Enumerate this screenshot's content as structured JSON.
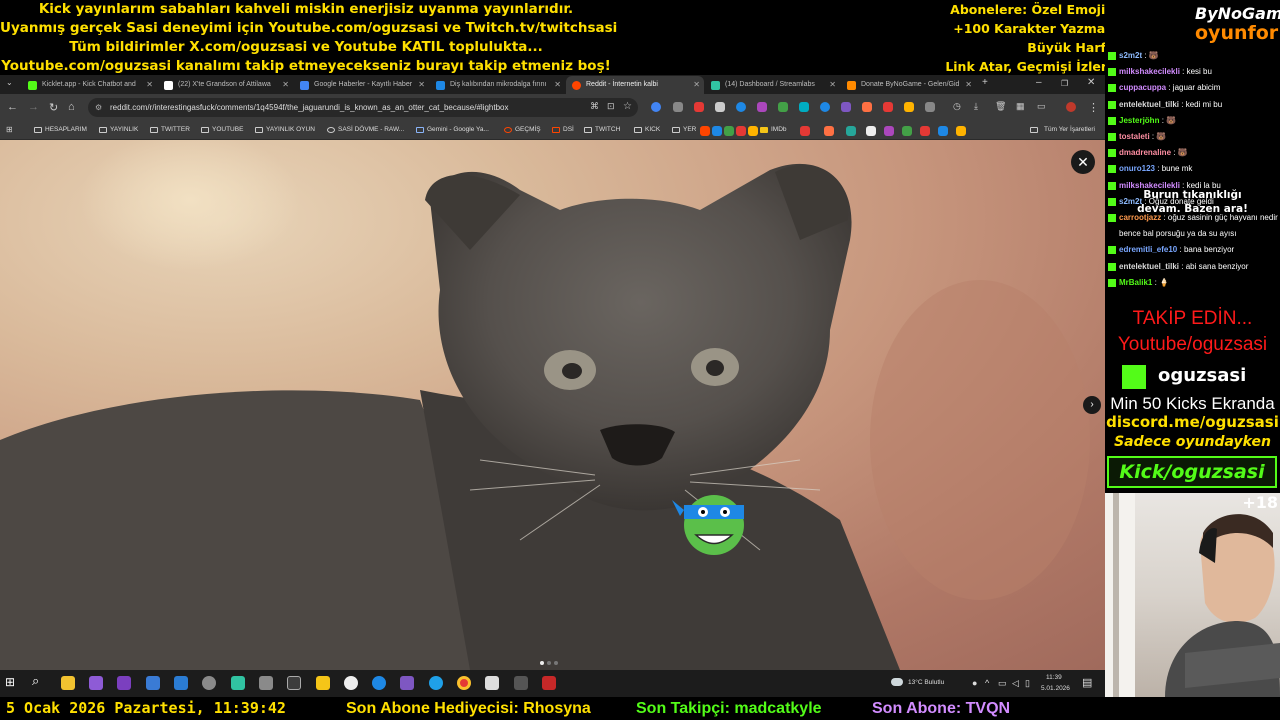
{
  "overlay": {
    "announce_lines": [
      "Kick yayınlarım sabahları kahveli miskin enerjisiz uyanma yayınlarıdır.",
      "Uyanmış gerçek Sasi deneyimi için Youtube.com/oguzsasi ve Twitch.tv/twitchsasi",
      "Tüm bildirimler X.com/oguzsasi ve Youtube KATIL toplulukta...",
      "Youtube.com/oguzsasi kanalımı takip etmeyecekseniz burayı takip etmeniz boş!"
    ],
    "sub_perks_lines": [
      "Abonelere: Özel Emoji,",
      "+100 Karakter Yazma,",
      "Büyük Harf,",
      "Link Atar, Geçmişi İzler."
    ],
    "accent_color": "#ffe000"
  },
  "browser": {
    "tabs": [
      {
        "label": "Kicklet.app - Kick Chatbot and",
        "color": "#53fc18",
        "active": false
      },
      {
        "label": "(22) X'te Grandson of Attilawa",
        "color": "#ffffff",
        "active": false
      },
      {
        "label": "Google Haberler - Kayıtlı Haber",
        "color": "#4285f4",
        "active": false
      },
      {
        "label": "Diş kalıbından mikrodalga fırını",
        "color": "#1e88e5",
        "active": false
      },
      {
        "label": "Reddit - İnternetin kalbi",
        "color": "#ff4500",
        "active": true
      },
      {
        "label": "(14) Dashboard / Streamlabs",
        "color": "#31c3a2",
        "active": false
      },
      {
        "label": "Donate ByNoGame - Gelen/Gid",
        "color": "#ff8a00",
        "active": false
      }
    ],
    "new_tab_label": "+",
    "url": "reddit.com/r/interestingasfuck/comments/1q4594f/the_jaguarundi_is_known_as_an_otter_cat_because/#lightbox",
    "bookmarks": [
      "HESAPLARIM",
      "YAYINLIK",
      "TWITTER",
      "YOUTUBE",
      "YAYINLIK OYUN",
      "SASİ DÖVME - RAW...",
      "Gemini - Google Ya...",
      "GEÇMİŞ",
      "DSİ",
      "TWITCH",
      "KICK",
      "YER",
      "IMDb"
    ],
    "all_bookmarks_label": "Tüm Yer İşaretleri",
    "lightbox_close": "✕",
    "lightbox_next": "›",
    "image_subject": "jaguarundi"
  },
  "taskbar": {
    "weather": "13°C  Bulutlu",
    "time": "11:39",
    "date": "5.01.2026"
  },
  "ticker": {
    "datetime": "5 Ocak 2026 Pazartesi, 11:39:42",
    "gifter": "Son Abone Hediyecisi: Rhosyna",
    "follower": "Son Takipçi: madcatkyle",
    "subscriber": "Son Abone: TVQN"
  },
  "brand": {
    "line1": "ByNoGame",
    "line2": "oyunfor"
  },
  "chat": [
    {
      "user": "s2m2t",
      "text": "🐻",
      "color": "#8fbcff"
    },
    {
      "user": "milkshakecilekli",
      "text": "kesi bu",
      "color": "#d28cff"
    },
    {
      "user": "cuppacuppa",
      "text": "jaguar abicim",
      "color": "#d28cff"
    },
    {
      "user": "entelektuel_tilki",
      "text": "kedi mi bu",
      "color": "#d9d9d9"
    },
    {
      "user": "Jesterjöhn",
      "text": "🐻",
      "color": "#53fc18"
    },
    {
      "user": "tostaleti",
      "text": "🐻",
      "color": "#ff8fa3"
    },
    {
      "user": "dmadrenaline",
      "text": "🐻",
      "color": "#ff8fa3"
    },
    {
      "user": "onuro123",
      "text": "bune mk",
      "color": "#7aa7ff"
    },
    {
      "user": "milkshakecilekli",
      "text": "kedi la bu",
      "color": "#d28cff"
    },
    {
      "user": "s2m2t",
      "text": "Oğuz donate geldi",
      "color": "#8fbcff"
    },
    {
      "user": "carrootjazz",
      "text": "oğuz sasinin güç hayvanı nedir bence bal porsuğu ya da su ayısı",
      "color": "#ff9a4d"
    },
    {
      "user": "edremitli_efe10",
      "text": "bana benziyor",
      "color": "#7aa7ff"
    },
    {
      "user": "entelektuel_tilki",
      "text": "abi sana benziyor",
      "color": "#d9d9d9"
    },
    {
      "user": "MrBalik1",
      "text": "🍦",
      "color": "#53fc18"
    }
  ],
  "promo": {
    "follow_cta": "TAKİP EDİN...",
    "youtube": "Youtube/oguzsasi",
    "kick_name": "oguzsasi",
    "min_kicks": "Min 50 Kicks Ekranda",
    "discord": "discord.me/oguzsasi",
    "only_ingame": "Sadece oyundayken",
    "kick_banner": "Kick/oguzsasi",
    "kick_color": "#53fc18"
  },
  "webcam": {
    "age_badge": "+18",
    "caption_line1": "Burun tıkanıklığı",
    "caption_line2": "devam. Bazen ara!"
  }
}
